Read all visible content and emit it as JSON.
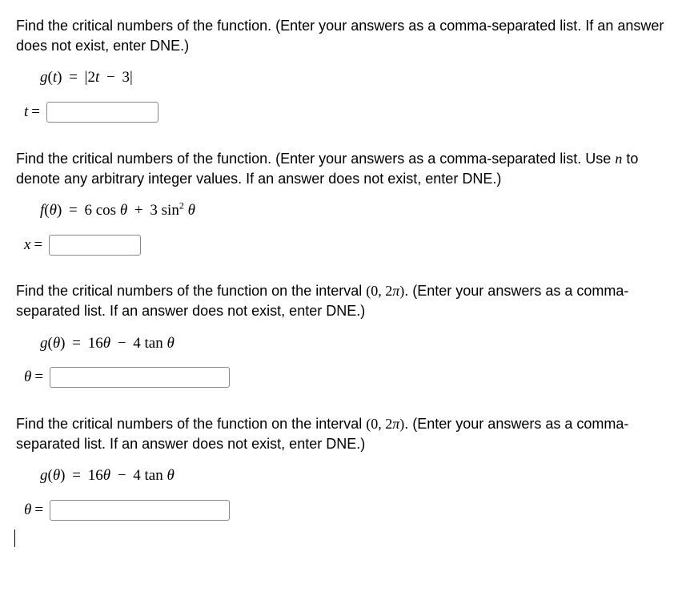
{
  "problems": [
    {
      "question_pre": "Find the critical numbers of the function. (Enter your answers as a comma-separated list. If an answer does not exist, enter DNE.)",
      "question_post": "",
      "equation_lhs": "g(t)",
      "equation_rhs": "|2t − 3|",
      "answer_var": "t",
      "input_value": "",
      "input_width": "w-140"
    },
    {
      "question_pre": "Find the critical numbers of the function. (Enter your answers as a comma-separated list. Use ",
      "question_n": "n",
      "question_post": " to denote any arbitrary integer values. If an answer does not exist, enter DNE.)",
      "equation_lhs": "f(θ)",
      "equation_rhs": "6 cos θ + 3 sin² θ",
      "answer_var": "x",
      "input_value": "",
      "input_width": "w-120"
    },
    {
      "question_pre": "Find the critical numbers of the function on the interval ",
      "interval": "(0, 2π)",
      "question_post": ". (Enter your answers as a comma-separated list. If an answer does not exist, enter DNE.)",
      "equation_lhs": "g(θ)",
      "equation_rhs": "16θ − 4 tan θ",
      "answer_var": "θ",
      "input_value": "",
      "input_width": "w-230"
    },
    {
      "question_pre": "Find the critical numbers of the function on the interval ",
      "interval": "(0, 2π)",
      "question_post": ". (Enter your answers as a comma-separated list. If an answer does not exist, enter DNE.)",
      "equation_lhs": "g(θ)",
      "equation_rhs": "16θ − 4 tan θ",
      "answer_var": "θ",
      "input_value": "",
      "input_width": "w-230"
    }
  ]
}
